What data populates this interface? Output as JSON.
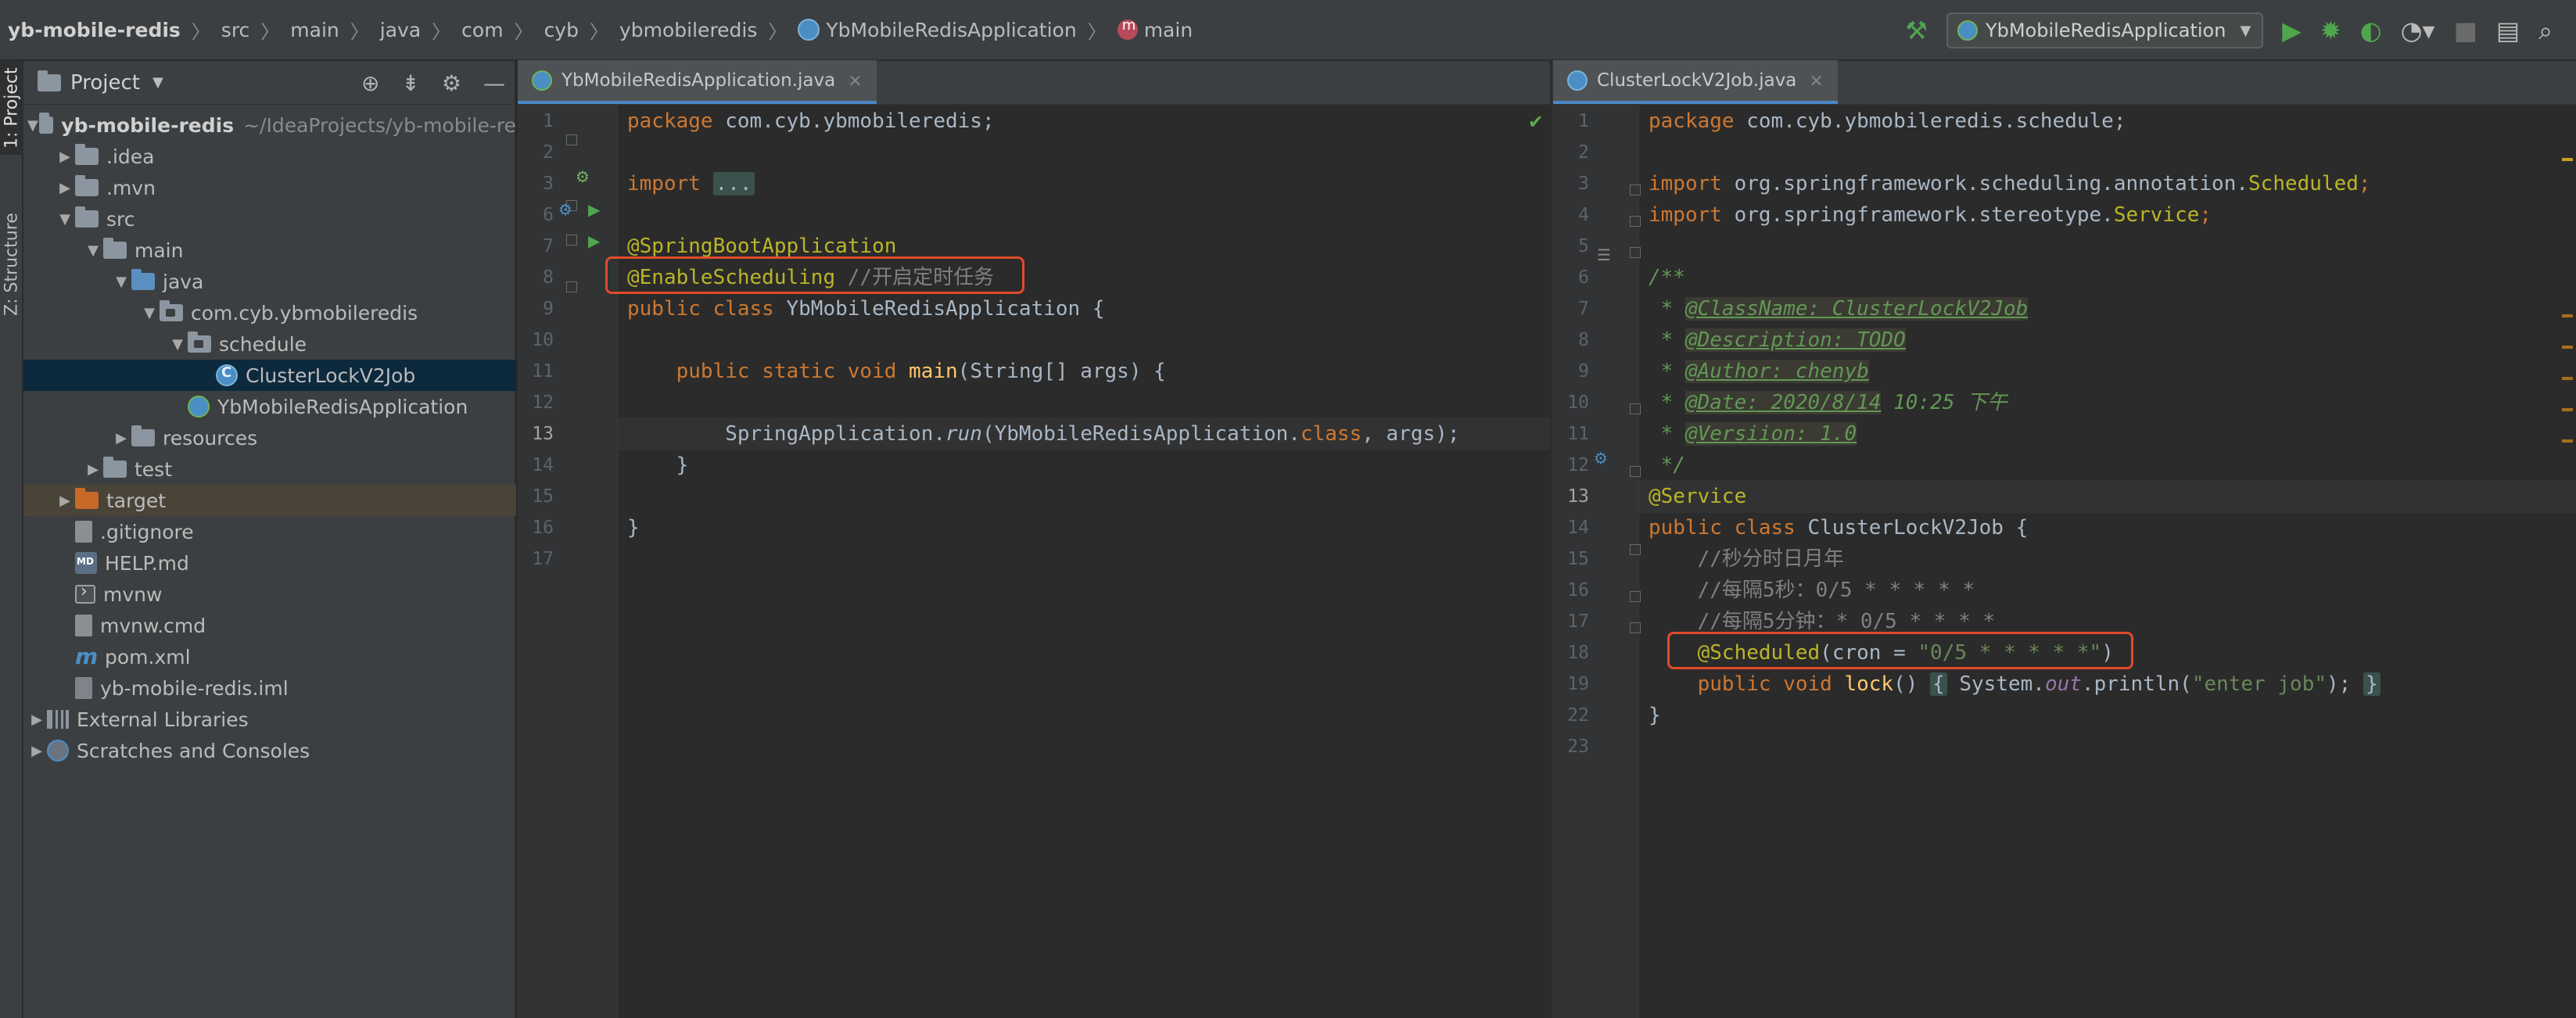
{
  "navbar": {
    "breadcrumbs": [
      {
        "label": "yb-mobile-redis",
        "icon": ""
      },
      {
        "label": "src",
        "icon": ""
      },
      {
        "label": "main",
        "icon": ""
      },
      {
        "label": "java",
        "icon": ""
      },
      {
        "label": "com",
        "icon": ""
      },
      {
        "label": "cyb",
        "icon": ""
      },
      {
        "label": "ybmobileredis",
        "icon": ""
      },
      {
        "label": "YbMobileRedisApplication",
        "icon": "class-icon"
      },
      {
        "label": "main",
        "icon": "method-icon"
      }
    ],
    "run_config": "YbMobileRedisApplication",
    "toolbar_icons": [
      "build-hammer-icon",
      "run-icon",
      "debug-icon",
      "coverage-icon",
      "profile-icon",
      "stop-icon",
      "project-structure-icon",
      "search-everywhere-icon"
    ]
  },
  "tool_strip": {
    "project_tab": "1: Project",
    "structure_tab": "Z: Structure"
  },
  "project_panel": {
    "title": "Project",
    "tree": [
      {
        "label": "yb-mobile-redis",
        "path": "~/IdeaProjects/yb-mobile-re",
        "level": 0,
        "arrow": "▼",
        "icon": "folder"
      },
      {
        "label": ".idea",
        "level": 1,
        "arrow": "▶",
        "icon": "folder"
      },
      {
        "label": ".mvn",
        "level": 1,
        "arrow": "▶",
        "icon": "folder"
      },
      {
        "label": "src",
        "level": 1,
        "arrow": "▼",
        "icon": "folder"
      },
      {
        "label": "main",
        "level": 2,
        "arrow": "▼",
        "icon": "folder"
      },
      {
        "label": "java",
        "level": 3,
        "arrow": "▼",
        "icon": "folder-blue"
      },
      {
        "label": "com.cyb.ybmobileredis",
        "level": 4,
        "arrow": "▼",
        "icon": "package"
      },
      {
        "label": "schedule",
        "level": 5,
        "arrow": "▼",
        "icon": "package"
      },
      {
        "label": "ClusterLockV2Job",
        "level": 6,
        "arrow": "",
        "icon": "class",
        "selected": true
      },
      {
        "label": "YbMobileRedisApplication",
        "level": 5,
        "arrow": "",
        "icon": "class-run"
      },
      {
        "label": "resources",
        "level": 3,
        "arrow": "▶",
        "icon": "folder-res"
      },
      {
        "label": "test",
        "level": 2,
        "arrow": "▶",
        "icon": "folder"
      },
      {
        "label": "target",
        "level": 1,
        "arrow": "▶",
        "icon": "folder-orange",
        "highlight": true
      },
      {
        "label": ".gitignore",
        "level": 1,
        "arrow": "",
        "icon": "file"
      },
      {
        "label": "HELP.md",
        "level": 1,
        "arrow": "",
        "icon": "md"
      },
      {
        "label": "mvnw",
        "level": 1,
        "arrow": "",
        "icon": "term"
      },
      {
        "label": "mvnw.cmd",
        "level": 1,
        "arrow": "",
        "icon": "file"
      },
      {
        "label": "pom.xml",
        "level": 1,
        "arrow": "",
        "icon": "maven"
      },
      {
        "label": "yb-mobile-redis.iml",
        "level": 1,
        "arrow": "",
        "icon": "iml"
      },
      {
        "label": "External Libraries",
        "level": 0,
        "arrow": "▶",
        "icon": "lib"
      },
      {
        "label": "Scratches and Consoles",
        "level": 0,
        "arrow": "▶",
        "icon": "scratch"
      }
    ]
  },
  "editor_left": {
    "tab": "YbMobileRedisApplication.java",
    "line_numbers": [
      "1",
      "2",
      "3",
      "6",
      "7",
      "8",
      "9",
      "10",
      "11",
      "12",
      "13",
      "14",
      "15",
      "16",
      "17"
    ],
    "current_line": "13"
  },
  "editor_right": {
    "tab": "ClusterLockV2Job.java",
    "line_numbers": [
      "1",
      "2",
      "3",
      "4",
      "5",
      "6",
      "7",
      "8",
      "9",
      "10",
      "11",
      "12",
      "13",
      "14",
      "15",
      "16",
      "17",
      "18",
      "19",
      "22",
      "23"
    ],
    "current_line": "13"
  },
  "code_left": {
    "l1_kw": "package",
    "l1_rest": " com.cyb.ybmobileredis;",
    "l3_kw": "import",
    "l3_fold": "...",
    "l7_ann": "@SpringBootApplication",
    "l8_ann": "@EnableScheduling",
    "l8_cmt": " //开启定时任务",
    "l9_kw": "public class",
    "l9_rest": " YbMobileRedisApplication {",
    "l11_kw": "public static void",
    "l11_fn": "main",
    "l11_rest": "(String[] args) {",
    "l13_cls": "SpringApplication",
    "l13_dot": ".",
    "l13_run": "run",
    "l13_mid": "(YbMobileRedisApplication.",
    "l13_kw": "class",
    "l13_end": ", args);",
    "l14": "}",
    "l16": "}"
  },
  "code_right": {
    "l1_kw": "package",
    "l1_rest": " com.cyb.ybmobileredis.schedule;",
    "l3_kw": "import",
    "l3_rest": " org.springframework.scheduling.annotation.",
    "l3_ann": "Scheduled",
    "l3_end": ";",
    "l4_kw": "import",
    "l4_rest": " org.springframework.stereotype.",
    "l4_ann": "Service",
    "l4_end": ";",
    "l6": "/**",
    "l7_star": " * ",
    "l7_tag": "@ClassName: ClusterLockV2Job",
    "l8_star": " * ",
    "l8_tag": "@Description: TODO",
    "l9_star": " * ",
    "l9_tag": "@Author: chenyb",
    "l10_star": " * ",
    "l10_tag": "@Date: 2020/8/14",
    "l10_rest": " 10:25 下午",
    "l11_star": " * ",
    "l11_tag": "@Versiion: 1.0",
    "l12": " */",
    "l13_ann": "@Service",
    "l14_kw": "public class",
    "l14_rest": " ClusterLockV2Job {",
    "l15": "    //秒分时日月年",
    "l16": "    //每隔5秒：0/5 * * * * *",
    "l17": "    //每隔5分钟：* 0/5 * * * *",
    "l18_indent": "    ",
    "l18_ann": "@Scheduled",
    "l18_mid": "(cron = ",
    "l18_str": "\"0/5 * * * * *\"",
    "l18_end": ")",
    "l19_indent": "    ",
    "l19_kw": "public void",
    "l19_sp": " ",
    "l19_fn": "lock",
    "l19_mid": "() ",
    "l19_brace1": "{",
    "l19_body": " System.",
    "l19_out": "out",
    "l19_call": ".println(",
    "l19_str": "\"enter job\"",
    "l19_semi": "); ",
    "l19_brace2": "}",
    "l22": "}"
  }
}
